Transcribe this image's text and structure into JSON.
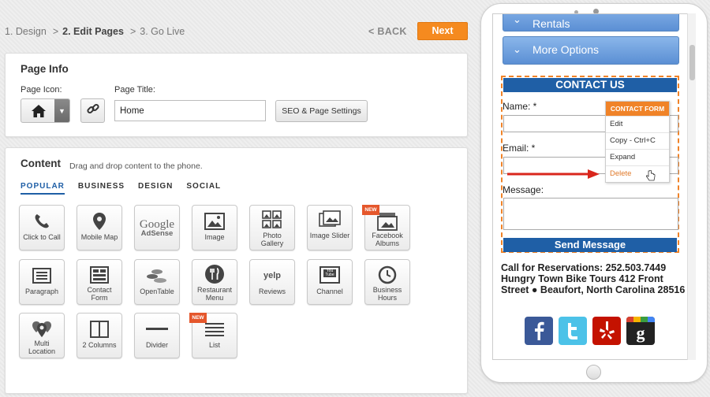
{
  "steps": [
    {
      "label": "1. Design",
      "active": false
    },
    {
      "label": "2. Edit Pages",
      "active": true
    },
    {
      "label": "3. Go Live",
      "active": false
    }
  ],
  "step_separator": ">",
  "back_label": "< BACK",
  "next_label": "Next",
  "page_info": {
    "title": "Page Info",
    "icon_label": "Page Icon:",
    "page_title_label": "Page Title:",
    "page_title_value": "Home",
    "seo_button": "SEO & Page Settings"
  },
  "content": {
    "title": "Content",
    "subtitle": "Drag and drop content to the phone.",
    "tabs": [
      "POPULAR",
      "BUSINESS",
      "DESIGN",
      "SOCIAL"
    ],
    "tiles": [
      {
        "label": "Click to Call",
        "icon": "phone-icon"
      },
      {
        "label": "Mobile Map",
        "icon": "map-pin-icon"
      },
      {
        "label": "AdSense",
        "icon": "google-icon",
        "brand": "Google"
      },
      {
        "label": "Image",
        "icon": "image-icon"
      },
      {
        "label": "Photo Gallery",
        "icon": "gallery-icon"
      },
      {
        "label": "Image Slider",
        "icon": "slider-icon"
      },
      {
        "label": "Facebook Albums",
        "icon": "facebook-albums-icon",
        "badge": "NEW"
      },
      {
        "label": "Paragraph",
        "icon": "paragraph-icon"
      },
      {
        "label": "Contact Form",
        "icon": "form-icon"
      },
      {
        "label": "OpenTable",
        "icon": "opentable-icon"
      },
      {
        "label": "Restaurant Menu",
        "icon": "menu-utensils-icon"
      },
      {
        "label": "Reviews",
        "icon": "yelp-icon",
        "brand": "yelp"
      },
      {
        "label": "Channel",
        "icon": "youtube-channel-icon",
        "brand": "You Tube"
      },
      {
        "label": "Business Hours",
        "icon": "clock-icon"
      },
      {
        "label": "Multi Location",
        "icon": "multi-pin-icon"
      },
      {
        "label": "2 Columns",
        "icon": "columns-icon"
      },
      {
        "label": "Divider",
        "icon": "divider-icon"
      },
      {
        "label": "List",
        "icon": "list-icon",
        "badge": "NEW"
      }
    ]
  },
  "phone": {
    "top_button_partial": "Rentals",
    "more_options": "More Options",
    "contact_title": "CONTACT US",
    "fields": [
      {
        "label": "Name:  *"
      },
      {
        "label": "Email:  *"
      },
      {
        "label": "Message:"
      }
    ],
    "send_button": "Send Message",
    "context_menu": {
      "header": "CONTACT FORM",
      "items": [
        "Edit",
        "Copy - Ctrl+C",
        "Expand",
        "Delete"
      ]
    },
    "reservations_text": "Call for Reservations: 252.503.7449  Hungry Town Bike Tours 412 Front Street  ● Beaufort, North Carolina 28516",
    "social": [
      "facebook-icon",
      "twitter-icon",
      "yelp-icon",
      "google-plus-icon"
    ]
  },
  "colors": {
    "accent_orange": "#f58a1f",
    "brand_blue": "#1f5fa6",
    "arrow_red": "#d9261c"
  }
}
